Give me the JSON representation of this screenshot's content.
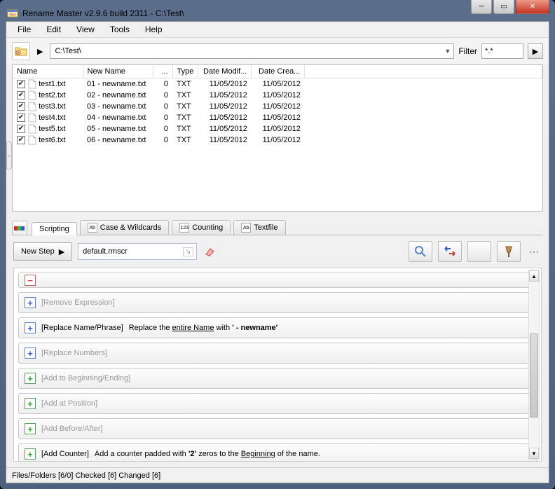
{
  "window": {
    "title": "Rename Master v2.9.6 build 2311 - C:\\Test\\"
  },
  "menu": {
    "file": "File",
    "edit": "Edit",
    "view": "View",
    "tools": "Tools",
    "help": "Help"
  },
  "path": {
    "value": "C:\\Test\\"
  },
  "filter": {
    "label": "Filter",
    "value": "*.*"
  },
  "columns": {
    "name": "Name",
    "newname": "New Name",
    "size": "...",
    "type": "Type",
    "modified": "Date Modif...",
    "created": "Date Crea..."
  },
  "files": [
    {
      "name": "test1.txt",
      "newname": "01 - newname.txt",
      "size": "0",
      "type": "TXT",
      "modified": "11/05/2012",
      "created": "11/05/2012"
    },
    {
      "name": "test2.txt",
      "newname": "02 - newname.txt",
      "size": "0",
      "type": "TXT",
      "modified": "11/05/2012",
      "created": "11/05/2012"
    },
    {
      "name": "test3.txt",
      "newname": "03 - newname.txt",
      "size": "0",
      "type": "TXT",
      "modified": "11/05/2012",
      "created": "11/05/2012"
    },
    {
      "name": "test4.txt",
      "newname": "04 - newname.txt",
      "size": "0",
      "type": "TXT",
      "modified": "11/05/2012",
      "created": "11/05/2012"
    },
    {
      "name": "test5.txt",
      "newname": "05 - newname.txt",
      "size": "0",
      "type": "TXT",
      "modified": "11/05/2012",
      "created": "11/05/2012"
    },
    {
      "name": "test6.txt",
      "newname": "06 - newname.txt",
      "size": "0",
      "type": "TXT",
      "modified": "11/05/2012",
      "created": "11/05/2012"
    }
  ],
  "tabs": {
    "scripting": "Scripting",
    "case": "Case & Wildcards",
    "counting": "Counting",
    "textfile": "Textfile"
  },
  "script": {
    "newstep": "New Step",
    "name": "default.rmscr"
  },
  "steps": {
    "removeexpr": "[Remove Expression]",
    "replacename_label": "[Replace Name/Phrase]",
    "replacename_pre": "Replace the ",
    "replacename_u": "entire Name",
    "replacename_mid": " with ",
    "replacename_val": "' - newname'",
    "replacenum": "[Replace Numbers]",
    "addbe": "[Add to Beginning/Ending]",
    "addpos": "[Add at Position]",
    "addba": "[Add Before/After]",
    "addcounter_label": "[Add Counter]",
    "addcounter_pre": "Add a counter padded with ",
    "addcounter_val": "'2'",
    "addcounter_mid": " zeros to the ",
    "addcounter_u": "Beginning",
    "addcounter_post": " of the name."
  },
  "status": {
    "text": "Files/Folders [6/0] Checked [6] Changed [6]"
  }
}
